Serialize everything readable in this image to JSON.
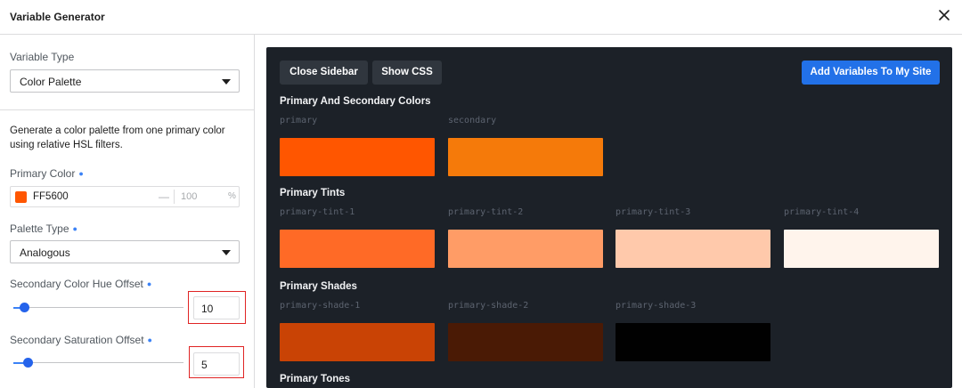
{
  "window": {
    "title": "Variable Generator"
  },
  "sidebar": {
    "variable_type_label": "Variable Type",
    "variable_type_value": "Color Palette",
    "description": "Generate a color palette from one primary color using relative HSL filters.",
    "primary_color_label": "Primary Color",
    "primary_color": {
      "hex_text": "FF5600",
      "swatch": "#FF5600",
      "alpha_placeholder": "100",
      "alpha_unit": "%"
    },
    "palette_type_label": "Palette Type",
    "palette_type_value": "Analogous",
    "hue_offset_label": "Secondary Color Hue Offset",
    "hue_offset_value": "10",
    "hue_offset_fraction": 0.04,
    "saturation_offset_label": "Secondary Saturation Offset",
    "saturation_offset_value": "5",
    "saturation_offset_fraction": 0.06
  },
  "toolbar": {
    "close_sidebar": "Close Sidebar",
    "show_css": "Show CSS",
    "add_variables": "Add Variables To My Site"
  },
  "sections": [
    {
      "title": "Primary And Secondary Colors",
      "swatches": [
        {
          "name": "primary",
          "color": "#FF5600"
        },
        {
          "name": "secondary",
          "color": "#F57A0A"
        }
      ]
    },
    {
      "title": "Primary Tints",
      "swatches": [
        {
          "name": "primary-tint-1",
          "color": "#FF6A26"
        },
        {
          "name": "primary-tint-2",
          "color": "#FF9C66"
        },
        {
          "name": "primary-tint-3",
          "color": "#FFC9AB"
        },
        {
          "name": "primary-tint-4",
          "color": "#FFF4EC"
        }
      ]
    },
    {
      "title": "Primary Shades",
      "swatches": [
        {
          "name": "primary-shade-1",
          "color": "#C94305"
        },
        {
          "name": "primary-shade-2",
          "color": "#4A1A05"
        },
        {
          "name": "primary-shade-3",
          "color": "#010101"
        }
      ]
    },
    {
      "title": "Primary Tones",
      "swatches": []
    }
  ],
  "colors": {
    "accent": "#2271E8",
    "panel_bg": "#1C2128",
    "highlight_border": "#E02424"
  }
}
